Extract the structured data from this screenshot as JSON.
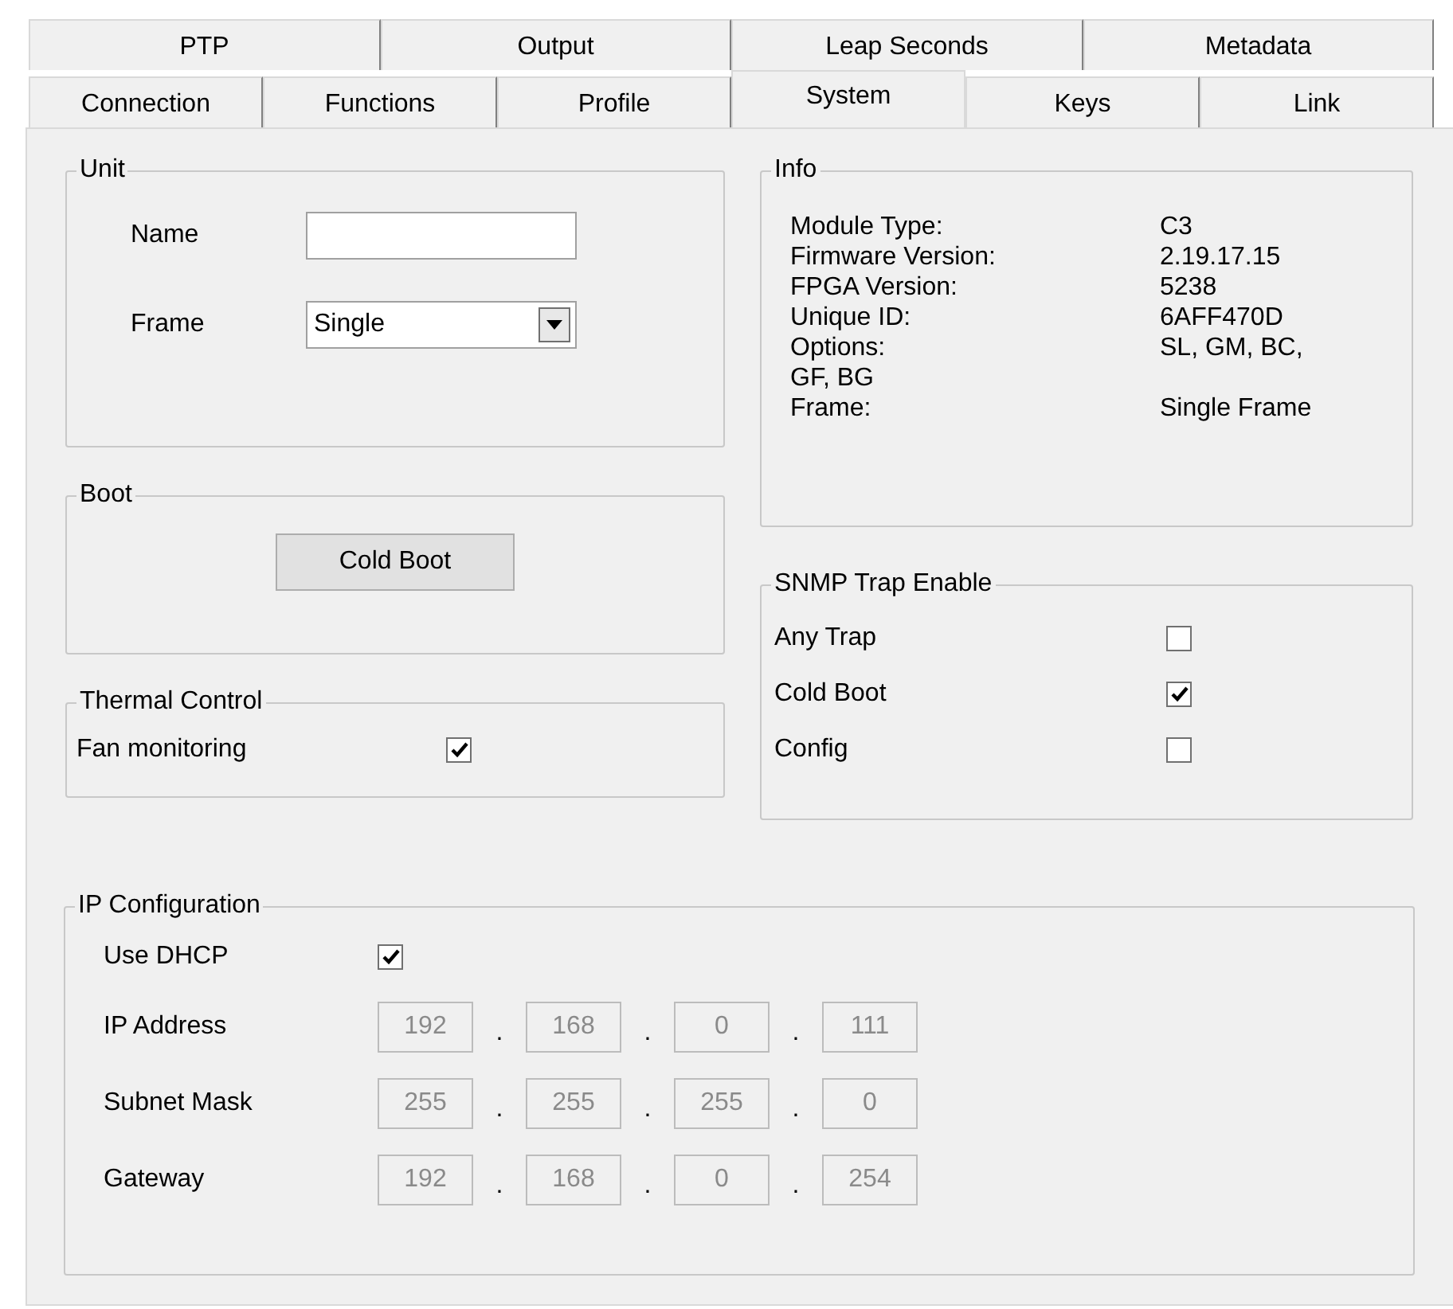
{
  "tab_rows": [
    [
      {
        "label": "PTP",
        "selected": false
      },
      {
        "label": "Output",
        "selected": false
      },
      {
        "label": "Leap Seconds",
        "selected": false
      },
      {
        "label": "Metadata",
        "selected": false
      }
    ],
    [
      {
        "label": "Connection",
        "selected": false
      },
      {
        "label": "Functions",
        "selected": false
      },
      {
        "label": "Profile",
        "selected": false
      },
      {
        "label": "System",
        "selected": true
      },
      {
        "label": "Keys",
        "selected": false
      },
      {
        "label": "Link",
        "selected": false
      }
    ]
  ],
  "unit": {
    "title": "Unit",
    "name_label": "Name",
    "frame_label": "Frame",
    "frame_value": "Single"
  },
  "boot": {
    "title": "Boot",
    "button": "Cold Boot"
  },
  "thermal": {
    "title": "Thermal Control",
    "items": [
      {
        "label": "Fan monitoring",
        "checked": true
      }
    ]
  },
  "info": {
    "title": "Info",
    "rows": [
      {
        "label": "Module Type:",
        "value": "C3"
      },
      {
        "label": "Firmware Version:",
        "value": "2.19.17.15"
      },
      {
        "label": "FPGA Version:",
        "value": "5238"
      },
      {
        "label": "Unique ID:",
        "value": "6AFF470D"
      },
      {
        "label": "Options:",
        "value": "SL, GM, BC,"
      },
      {
        "label": "GF, BG"
      },
      {
        "label": "Frame:",
        "value": "Single Frame"
      }
    ]
  },
  "snmp": {
    "title": "SNMP Trap Enable",
    "items": [
      {
        "label": "Any Trap",
        "checked": false
      },
      {
        "label": "Cold Boot",
        "checked": true
      },
      {
        "label": "Config",
        "checked": false
      }
    ]
  },
  "ip_config": {
    "title": "IP Configuration",
    "dhcp": {
      "label": "Use DHCP",
      "checked": true
    },
    "separator": ".",
    "disabled": true,
    "rows": [
      {
        "label": "IP Address",
        "octets": [
          "192",
          "168",
          "0",
          "111"
        ]
      },
      {
        "label": "Subnet Mask",
        "octets": [
          "255",
          "255",
          "255",
          "0"
        ]
      },
      {
        "label": "Gateway",
        "octets": [
          "192",
          "168",
          "0",
          "254"
        ]
      }
    ]
  }
}
